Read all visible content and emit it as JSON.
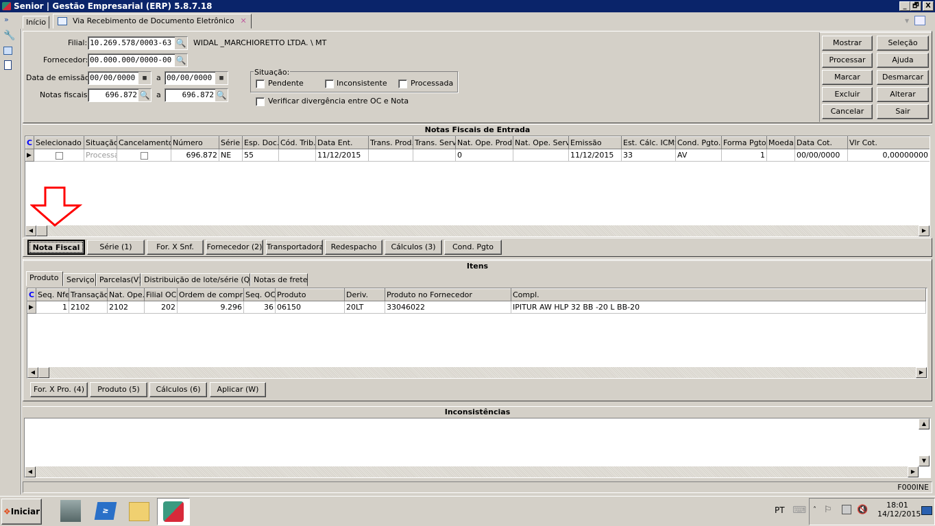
{
  "window": {
    "title": "Senior | Gestão Empresarial (ERP) 5.8.7.18",
    "minimize": "_",
    "restore": "🗗",
    "close": "X"
  },
  "tabs": [
    {
      "label": "Início"
    },
    {
      "label": "Via Recebimento de Documento Eletrônico"
    }
  ],
  "form": {
    "filial_label": "Filial:",
    "filial_value": "10.269.578/0003-63",
    "filial_name": "WIDAL _MARCHIORETTO LTDA. \\ MT",
    "fornecedor_label": "Fornecedor:",
    "fornecedor_value": "00.000.000/0000-00",
    "data_label": "Data de emissão:",
    "data_from": "00/00/0000",
    "data_to": "00/00/0000",
    "a": "a",
    "notas_label": "Notas fiscais:",
    "notas_from": "696.872",
    "notas_to": "696.872",
    "situacao_label": "Situação:",
    "pendente": "Pendente",
    "inconsistente": "Inconsistente",
    "processada": "Processada",
    "verificar": "Verificar divergência entre OC e Nota"
  },
  "actions": [
    "Mostrar",
    "Seleção",
    "Processar",
    "Ajuda",
    "Marcar",
    "Desmarcar",
    "Excluir",
    "Alterar",
    "Cancelar",
    "Sair"
  ],
  "notas": {
    "title": "Notas Fiscais de Entrada",
    "columns": [
      "C",
      "Selecionado",
      "Situação",
      "Cancelamento",
      "Número",
      "Série",
      "Esp. Doc.",
      "Cód. Trib.",
      "Data Ent.",
      "Trans. Prod.",
      "Trans. Serv.",
      "Nat. Ope. Prod.",
      "Nat. Ope. Serv.",
      "Emissão",
      "Est. Cálc. ICMS",
      "Cond. Pgto.",
      "Forma Pgto.",
      "Moeda",
      "Data Cot.",
      "Vlr Cot."
    ],
    "rows": [
      [
        "",
        "",
        "Processada",
        "",
        "696.872",
        "NE",
        "55",
        "",
        "11/12/2015",
        "",
        "",
        "0",
        "",
        "11/12/2015",
        "33",
        "AV",
        "1",
        "",
        "00/00/0000",
        "0,00000000"
      ]
    ],
    "buttons": [
      "Nota Fiscal",
      "Série (1)",
      "For. X Snf.",
      "Fornecedor (2)",
      "Transportadora",
      "Redespacho",
      "Cálculos (3)",
      "Cond. Pgto"
    ]
  },
  "itens": {
    "title": "Itens",
    "tabs": [
      "Produto",
      "Serviço",
      "Parcelas(V)",
      "Distribuição de lote/série (Q)",
      "Notas de frete"
    ],
    "columns": [
      "C",
      "Seq. Nfe",
      "Transação",
      "Nat. Ope.",
      "Filial OC",
      "Ordem de compra",
      "Seq. OC",
      "Produto",
      "Deriv.",
      "Produto no Fornecedor",
      "Compl."
    ],
    "rows": [
      [
        "",
        "1",
        "2102",
        "2102",
        "202",
        "9.296",
        "36",
        "06150",
        "20LT",
        "33046022",
        "IPITUR AW HLP 32 BB -20 L BB-20"
      ]
    ],
    "buttons": [
      "For. X Pro. (4)",
      "Produto (5)",
      "Cálculos (6)",
      "Aplicar (W)"
    ]
  },
  "inconsistencias": {
    "title": "Inconsistências"
  },
  "status": {
    "code": "F000INE"
  },
  "taskbar": {
    "start": "Iniciar",
    "lang": "PT",
    "time": "18:01",
    "date": "14/12/2015"
  },
  "colors": {
    "titlebar": "#0a246a",
    "annotation_arrow": "#ff0000"
  }
}
